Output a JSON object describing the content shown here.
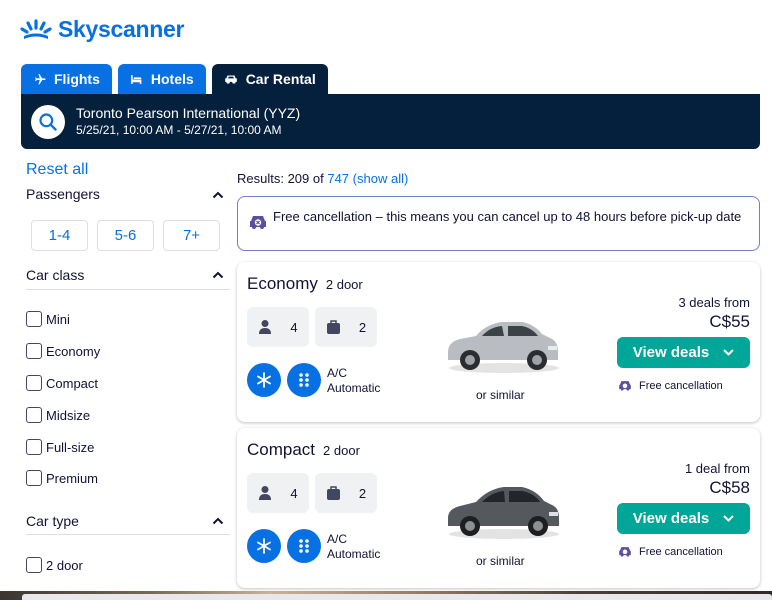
{
  "brand": {
    "name": "Skyscanner",
    "color": "#0770e3",
    "dark": "#05203c",
    "cta": "#00a698"
  },
  "tabs": [
    {
      "label": "Flights",
      "icon": "plane-icon",
      "active": false
    },
    {
      "label": "Hotels",
      "icon": "bed-icon",
      "active": false
    },
    {
      "label": "Car Rental",
      "icon": "car-icon",
      "active": true
    }
  ],
  "search": {
    "location": "Toronto Pearson International (YYZ)",
    "dates": "5/25/21, 10:00 AM - 5/27/21, 10:00 AM",
    "icon": "search-icon"
  },
  "filters": {
    "reset_label": "Reset all",
    "passengers": {
      "title": "Passengers",
      "options": [
        "1-4",
        "5-6",
        "7+"
      ]
    },
    "car_class": {
      "title": "Car class",
      "options": [
        "Mini",
        "Economy",
        "Compact",
        "Midsize",
        "Full-size",
        "Premium"
      ]
    },
    "car_type": {
      "title": "Car type",
      "options": [
        "2 door"
      ]
    }
  },
  "results": {
    "prefix": "Results: 209 of",
    "total": "747",
    "show_all": "(show all)"
  },
  "notice": {
    "text": "Free cancellation – this means you can cancel up to 48 hours before pick-up date",
    "icon": "car-cancel-icon"
  },
  "cards": [
    {
      "car_class": "Economy",
      "doors": "2 door",
      "passengers": "4",
      "bags": "2",
      "ac": "A/C",
      "transmission": "Automatic",
      "or_similar": "or similar",
      "deals_from": "3 deals from",
      "price": "C$55",
      "cta": "View deals",
      "free_cancellation": "Free cancellation",
      "car_color": "#b9bcc0"
    },
    {
      "car_class": "Compact",
      "doors": "2 door",
      "passengers": "4",
      "bags": "2",
      "ac": "A/C",
      "transmission": "Automatic",
      "or_similar": "or similar",
      "deals_from": "1 deal from",
      "price": "C$58",
      "cta": "View deals",
      "free_cancellation": "Free cancellation",
      "car_color": "#55585c"
    }
  ]
}
